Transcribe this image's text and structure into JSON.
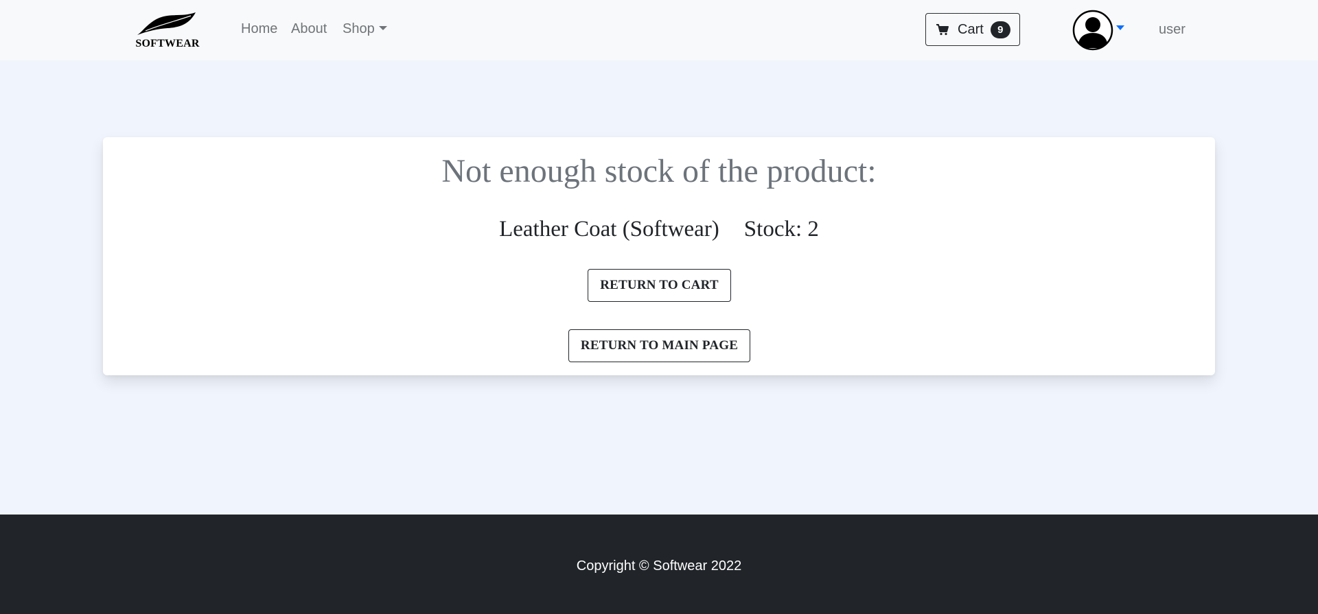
{
  "brand": {
    "name": "SOFTWEAR",
    "logo_icon": "feather-icon"
  },
  "nav": {
    "home_label": "Home",
    "about_label": "About",
    "shop_label": "Shop"
  },
  "cart": {
    "label": "Cart",
    "count": "9",
    "icon": "cart-icon"
  },
  "user": {
    "avatar_icon": "user-avatar-icon",
    "label": "user"
  },
  "message": {
    "title": "Not enough stock of the product:",
    "product_name": "Leather Coat (Softwear)",
    "stock_text": "Stock: 2"
  },
  "actions": {
    "return_cart_label": "RETURN TO CART",
    "return_main_label": "RETURN TO MAIN PAGE"
  },
  "footer": {
    "copyright": "Copyright © Softwear 2022"
  },
  "colors": {
    "page_bg": "#f0f4fc",
    "navbar_bg": "#f8f9fa",
    "footer_bg": "#212529",
    "title_gray": "#6c737b",
    "dropdown_accent": "#0d6efd"
  }
}
